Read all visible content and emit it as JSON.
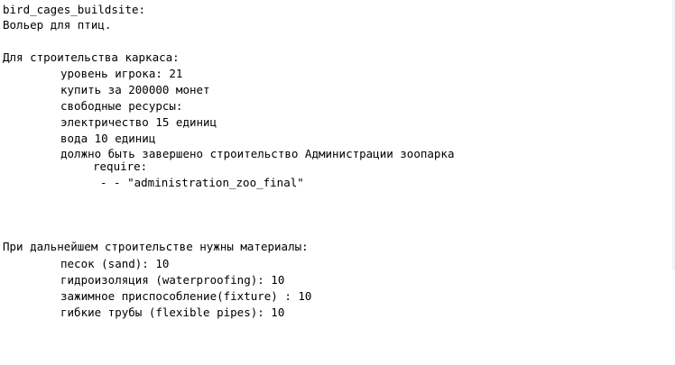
{
  "document": {
    "heading": "bird_cages_buildsite:",
    "subtitle": "Вольер для птиц.",
    "frame_section": {
      "title": "Для строительства каркаса:",
      "items": [
        "уровень игрока: 21",
        "купить за 200000 монет",
        "свободные ресурсы:",
        "электричество 15 единиц",
        "вода 10 единиц",
        "должно быть завершено строительство Администрации зоопарка"
      ],
      "require_label": "require:",
      "require_value": "- - \"administration_zoo_final\""
    },
    "materials_section": {
      "title": "При дальнейшем строительстве нужны материалы:",
      "items": [
        "песок (sand): 10",
        "гидроизоляция (waterproofing): 10",
        "зажимное приспособление(fixture) : 10",
        "гибкие трубы (flexible pipes): 10"
      ]
    }
  }
}
